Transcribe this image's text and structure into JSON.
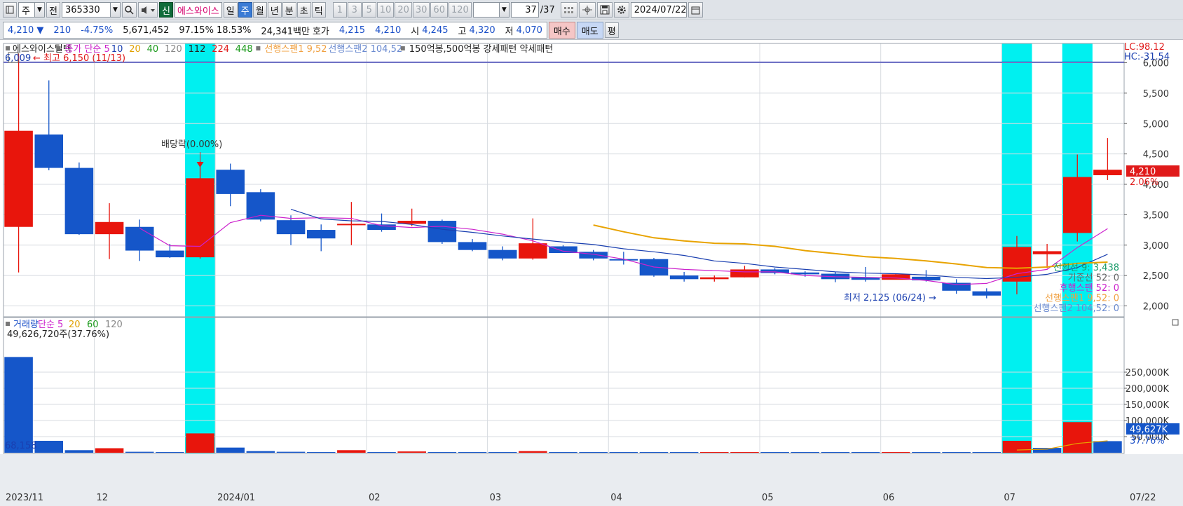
{
  "toolbar": {
    "period_type": "주",
    "market_button": "전",
    "code": "365330",
    "new_badge": "신",
    "stock_name": "에스와이스",
    "tabs": [
      "일",
      "주",
      "월",
      "년",
      "분",
      "초",
      "틱"
    ],
    "active_tab": "주",
    "intervals": [
      "1",
      "3",
      "5",
      "10",
      "20",
      "30",
      "60",
      "120"
    ],
    "page_index": "37",
    "page_total": "/37",
    "date": "2024/07/22"
  },
  "quote": {
    "price": "4,210",
    "change": "210",
    "change_pct": "-4.75%",
    "volume": "5,671,452",
    "vol_ratio": "97.15%",
    "turnover": "18.53%",
    "amount": "24,341백만",
    "bid_label": "호가",
    "ask": "4,215",
    "bid": "4,210",
    "open_label": "시",
    "open": "4,245",
    "high_label": "고",
    "high": "4,320",
    "low_label": "저",
    "low": "4,070",
    "buy_label": "매수",
    "sell_label": "매도",
    "eval_label": "평"
  },
  "price_panel": {
    "legend": [
      {
        "text": "에스와이스틸텍",
        "color": "#222222"
      },
      {
        "text": "종가 단순 5",
        "color": "#cc22cc"
      },
      {
        "text": "10",
        "color": "#1a3fb0"
      },
      {
        "text": "20",
        "color": "#e0a000"
      },
      {
        "text": "40",
        "color": "#1a9a1a"
      },
      {
        "text": "120",
        "color": "#888888"
      },
      {
        "text": "112",
        "color": "#222222"
      },
      {
        "text": "224",
        "color": "#e01a1a"
      },
      {
        "text": "448",
        "color": "#1a9a1a"
      },
      {
        "text": "선행스팬1 9,52",
        "color": "#f0a040"
      },
      {
        "text": "선행스팬2 104,52",
        "color": "#6a8ad0"
      },
      {
        "text": "150억봉,500억봉 강세패턴  약세패턴",
        "color": "#222222"
      }
    ],
    "top_left_value": "6,009",
    "max_label": "최고 6,150 (11/13)",
    "min_label": "최저 2,125 (06/24)",
    "dividend_label": "배당락(0.00%)",
    "lc_label": "LC:98.12",
    "hc_label": "HC:-31.54",
    "price_tag": "4,210",
    "price_tag_pct": "2.06%",
    "ichimoku_labels": [
      {
        "text": "전환선 9: 3,438",
        "color": "#1a9a6a"
      },
      {
        "text": "기준선 52: 0",
        "color": "#666666"
      },
      {
        "text": "후행스팬 52: 0",
        "color": "#cc22cc"
      },
      {
        "text": "선행스팬1 9,52: 0",
        "color": "#f0a040"
      },
      {
        "text": "선행스팬2 104,52: 0",
        "color": "#6a8ad0"
      }
    ]
  },
  "volume_panel": {
    "legend": [
      {
        "text": "거래량",
        "color": "#1a4fc8"
      },
      {
        "text": "단순 5",
        "color": "#cc22cc"
      },
      {
        "text": "20",
        "color": "#e0a000"
      },
      {
        "text": "60",
        "color": "#1a9a1a"
      },
      {
        "text": "120",
        "color": "#888888"
      }
    ],
    "max_label": "49,626,720주(37.76%)",
    "min_label": "68,158",
    "volume_tag": "49,627K",
    "volume_tag_pct": "37.76%"
  },
  "x_labels": [
    "2023/11",
    "12",
    "2024/01",
    "02",
    "03",
    "04",
    "05",
    "06",
    "07",
    "07/22"
  ],
  "colors": {
    "up": "#e8150c",
    "down": "#1556c9",
    "highlight": "#00f0f0",
    "ma5": "#cc22cc",
    "ma10": "#1a3fb0",
    "ma20": "#e8a300"
  },
  "chart_data": {
    "type": "candlestick",
    "period": "weekly",
    "price_axis_ticks": [
      2000,
      2500,
      3000,
      3500,
      4000,
      4500,
      5000,
      5500,
      6000
    ],
    "price_axis_labels": [
      "2,000",
      "2,500",
      "3,000",
      "3,500",
      "4,000",
      "4,500",
      "5,000",
      "5,500",
      "6,000"
    ],
    "volume_axis_ticks": [
      50000,
      100000,
      150000,
      200000,
      250000
    ],
    "volume_axis_labels": [
      "50,000K",
      "100,000K",
      "150,000K",
      "200,000K",
      "250,000K"
    ],
    "candles": [
      {
        "o": 3300,
        "h": 6150,
        "l": 2550,
        "c": 4880,
        "dir": "up"
      },
      {
        "o": 4820,
        "h": 5710,
        "l": 4230,
        "c": 4270,
        "dir": "down"
      },
      {
        "o": 4270,
        "h": 4360,
        "l": 3170,
        "c": 3180,
        "dir": "down"
      },
      {
        "o": 3180,
        "h": 3690,
        "l": 2770,
        "c": 3380,
        "dir": "up"
      },
      {
        "o": 3300,
        "h": 3420,
        "l": 2740,
        "c": 2910,
        "dir": "down"
      },
      {
        "o": 2910,
        "h": 3020,
        "l": 2790,
        "c": 2800,
        "dir": "down"
      },
      {
        "o": 2800,
        "h": 4380,
        "l": 2780,
        "c": 4100,
        "dir": "up"
      },
      {
        "o": 4240,
        "h": 4340,
        "l": 3640,
        "c": 3840,
        "dir": "down"
      },
      {
        "o": 3870,
        "h": 3920,
        "l": 3390,
        "c": 3420,
        "dir": "down"
      },
      {
        "o": 3410,
        "h": 3490,
        "l": 3000,
        "c": 3180,
        "dir": "down"
      },
      {
        "o": 3250,
        "h": 3340,
        "l": 2900,
        "c": 3110,
        "dir": "down"
      },
      {
        "o": 3330,
        "h": 3710,
        "l": 3000,
        "c": 3350,
        "dir": "up"
      },
      {
        "o": 3340,
        "h": 3520,
        "l": 3220,
        "c": 3250,
        "dir": "down"
      },
      {
        "o": 3350,
        "h": 3600,
        "l": 3310,
        "c": 3400,
        "dir": "up"
      },
      {
        "o": 3400,
        "h": 3420,
        "l": 3020,
        "c": 3050,
        "dir": "down"
      },
      {
        "o": 3050,
        "h": 3100,
        "l": 2900,
        "c": 2920,
        "dir": "down"
      },
      {
        "o": 2920,
        "h": 2980,
        "l": 2750,
        "c": 2780,
        "dir": "down"
      },
      {
        "o": 2780,
        "h": 3440,
        "l": 2760,
        "c": 3030,
        "dir": "up"
      },
      {
        "o": 2980,
        "h": 3000,
        "l": 2870,
        "c": 2870,
        "dir": "down"
      },
      {
        "o": 2890,
        "h": 2920,
        "l": 2750,
        "c": 2780,
        "dir": "down"
      },
      {
        "o": 2770,
        "h": 2890,
        "l": 2680,
        "c": 2770,
        "dir": "down"
      },
      {
        "o": 2770,
        "h": 2790,
        "l": 2480,
        "c": 2500,
        "dir": "down"
      },
      {
        "o": 2500,
        "h": 2560,
        "l": 2400,
        "c": 2440,
        "dir": "down"
      },
      {
        "o": 2440,
        "h": 2500,
        "l": 2400,
        "c": 2470,
        "dir": "up"
      },
      {
        "o": 2470,
        "h": 2660,
        "l": 2470,
        "c": 2600,
        "dir": "up"
      },
      {
        "o": 2600,
        "h": 2620,
        "l": 2520,
        "c": 2540,
        "dir": "down"
      },
      {
        "o": 2550,
        "h": 2570,
        "l": 2480,
        "c": 2520,
        "dir": "down"
      },
      {
        "o": 2530,
        "h": 2560,
        "l": 2390,
        "c": 2440,
        "dir": "down"
      },
      {
        "o": 2470,
        "h": 2640,
        "l": 2400,
        "c": 2430,
        "dir": "down"
      },
      {
        "o": 2430,
        "h": 2530,
        "l": 2440,
        "c": 2520,
        "dir": "up"
      },
      {
        "o": 2480,
        "h": 2590,
        "l": 2400,
        "c": 2420,
        "dir": "down"
      },
      {
        "o": 2380,
        "h": 2440,
        "l": 2200,
        "c": 2250,
        "dir": "down"
      },
      {
        "o": 2240,
        "h": 2290,
        "l": 2125,
        "c": 2170,
        "dir": "down"
      },
      {
        "o": 2400,
        "h": 3150,
        "l": 2190,
        "c": 2970,
        "dir": "up"
      },
      {
        "o": 2850,
        "h": 3020,
        "l": 2620,
        "c": 2900,
        "dir": "up"
      },
      {
        "o": 3200,
        "h": 4490,
        "l": 3060,
        "c": 4120,
        "dir": "up"
      },
      {
        "o": 4150,
        "h": 4760,
        "l": 4070,
        "c": 4240,
        "dir": "up"
      }
    ],
    "volume": [
      {
        "v": 297000,
        "dir": "down"
      },
      {
        "v": 37000,
        "dir": "down"
      },
      {
        "v": 8000,
        "dir": "down"
      },
      {
        "v": 14000,
        "dir": "up"
      },
      {
        "v": 3000,
        "dir": "down"
      },
      {
        "v": 2000,
        "dir": "down"
      },
      {
        "v": 60000,
        "dir": "up"
      },
      {
        "v": 16000,
        "dir": "down"
      },
      {
        "v": 5000,
        "dir": "down"
      },
      {
        "v": 3000,
        "dir": "down"
      },
      {
        "v": 2000,
        "dir": "down"
      },
      {
        "v": 8000,
        "dir": "up"
      },
      {
        "v": 2000,
        "dir": "down"
      },
      {
        "v": 4000,
        "dir": "up"
      },
      {
        "v": 1500,
        "dir": "down"
      },
      {
        "v": 1200,
        "dir": "down"
      },
      {
        "v": 1000,
        "dir": "down"
      },
      {
        "v": 5000,
        "dir": "up"
      },
      {
        "v": 1000,
        "dir": "down"
      },
      {
        "v": 900,
        "dir": "down"
      },
      {
        "v": 800,
        "dir": "down"
      },
      {
        "v": 800,
        "dir": "down"
      },
      {
        "v": 700,
        "dir": "down"
      },
      {
        "v": 600,
        "dir": "up"
      },
      {
        "v": 700,
        "dir": "up"
      },
      {
        "v": 600,
        "dir": "down"
      },
      {
        "v": 500,
        "dir": "down"
      },
      {
        "v": 500,
        "dir": "down"
      },
      {
        "v": 600,
        "dir": "down"
      },
      {
        "v": 600,
        "dir": "up"
      },
      {
        "v": 500,
        "dir": "down"
      },
      {
        "v": 800,
        "dir": "down"
      },
      {
        "v": 2000,
        "dir": "down"
      },
      {
        "v": 37000,
        "dir": "up"
      },
      {
        "v": 15000,
        "dir": "down"
      },
      {
        "v": 95000,
        "dir": "up"
      },
      {
        "v": 36000,
        "dir": "down"
      }
    ],
    "highlight_candles": [
      6,
      33,
      35
    ],
    "ma5": [
      null,
      null,
      null,
      null,
      3280,
      2990,
      2980,
      3370,
      3490,
      3440,
      3450,
      3440,
      3320,
      3290,
      3310,
      3260,
      3180,
      3070,
      2900,
      2850,
      2770,
      2640,
      2600,
      2580,
      2560,
      2560,
      2500,
      2480,
      2470,
      2460,
      2420,
      2350,
      2370,
      2530,
      2600,
      2960,
      3270
    ],
    "ma10": [
      null,
      null,
      null,
      null,
      null,
      null,
      null,
      null,
      null,
      3590,
      3430,
      3400,
      3390,
      3340,
      3260,
      3210,
      3150,
      3100,
      3050,
      3010,
      2940,
      2890,
      2830,
      2740,
      2700,
      2640,
      2600,
      2560,
      2540,
      2530,
      2510,
      2470,
      2450,
      2470,
      2520,
      2630,
      2850
    ],
    "ma20": [
      null,
      null,
      null,
      null,
      null,
      null,
      null,
      null,
      null,
      null,
      null,
      null,
      null,
      null,
      null,
      null,
      null,
      null,
      null,
      3330,
      3220,
      3120,
      3070,
      3030,
      3020,
      2980,
      2910,
      2860,
      2810,
      2780,
      2740,
      2690,
      2630,
      2620,
      2640,
      2700,
      2720
    ],
    "vol_ma5": [
      null,
      null,
      null,
      null,
      null,
      null,
      null,
      null,
      null,
      null,
      null,
      null,
      null,
      null,
      null,
      null,
      null,
      null,
      null,
      null,
      null,
      null,
      null,
      null,
      null,
      null,
      null,
      null,
      null,
      null,
      null,
      null,
      null,
      8500,
      11000,
      29000,
      37000
    ]
  }
}
